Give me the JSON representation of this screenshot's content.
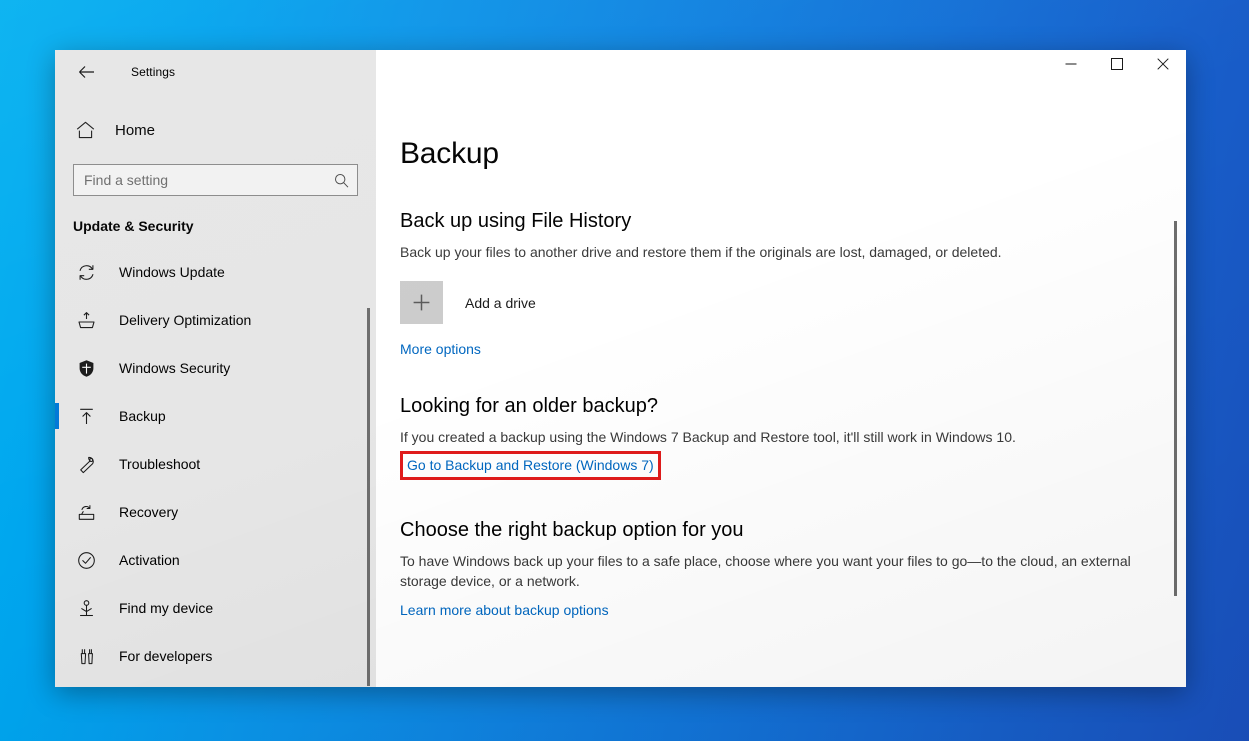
{
  "window": {
    "title": "Settings",
    "back_icon": "back-arrow-icon",
    "minimize_label": "Minimize",
    "maximize_label": "Maximize",
    "close_label": "Close"
  },
  "sidebar": {
    "home": {
      "label": "Home",
      "icon": "home-icon"
    },
    "search": {
      "placeholder": "Find a setting",
      "value": "",
      "icon": "search-icon"
    },
    "section_title": "Update & Security",
    "items": [
      {
        "label": "Windows Update",
        "icon": "refresh-icon",
        "selected": false
      },
      {
        "label": "Delivery Optimization",
        "icon": "upload-box-icon",
        "selected": false
      },
      {
        "label": "Windows Security",
        "icon": "shield-icon",
        "selected": false
      },
      {
        "label": "Backup",
        "icon": "upload-arrow-icon",
        "selected": true
      },
      {
        "label": "Troubleshoot",
        "icon": "wrench-icon",
        "selected": false
      },
      {
        "label": "Recovery",
        "icon": "recovery-icon",
        "selected": false
      },
      {
        "label": "Activation",
        "icon": "check-circle-icon",
        "selected": false
      },
      {
        "label": "Find my device",
        "icon": "locate-icon",
        "selected": false
      },
      {
        "label": "For developers",
        "icon": "tools-icon",
        "selected": false
      }
    ]
  },
  "main": {
    "page_title": "Backup",
    "file_history": {
      "heading": "Back up using File History",
      "description": "Back up your files to another drive and restore them if the originals are lost, damaged, or deleted.",
      "add_drive_label": "Add a drive",
      "add_drive_icon": "plus-icon",
      "more_options_label": "More options"
    },
    "older_backup": {
      "heading": "Looking for an older backup?",
      "description": "If you created a backup using the Windows 7 Backup and Restore tool, it'll still work in Windows 10.",
      "link_label": "Go to Backup and Restore (Windows 7)",
      "highlighted": true
    },
    "choose_option": {
      "heading": "Choose the right backup option for you",
      "description": "To have Windows back up your files to a safe place, choose where you want your files to go—to the cloud, an external storage device, or a network.",
      "link_label": "Learn more about backup options"
    }
  },
  "colors": {
    "accent": "#0078d7",
    "link": "#0067c0",
    "highlight_border": "#e01b1b",
    "sidebar_bg": "#e6e6e6",
    "content_bg": "#ffffff"
  }
}
